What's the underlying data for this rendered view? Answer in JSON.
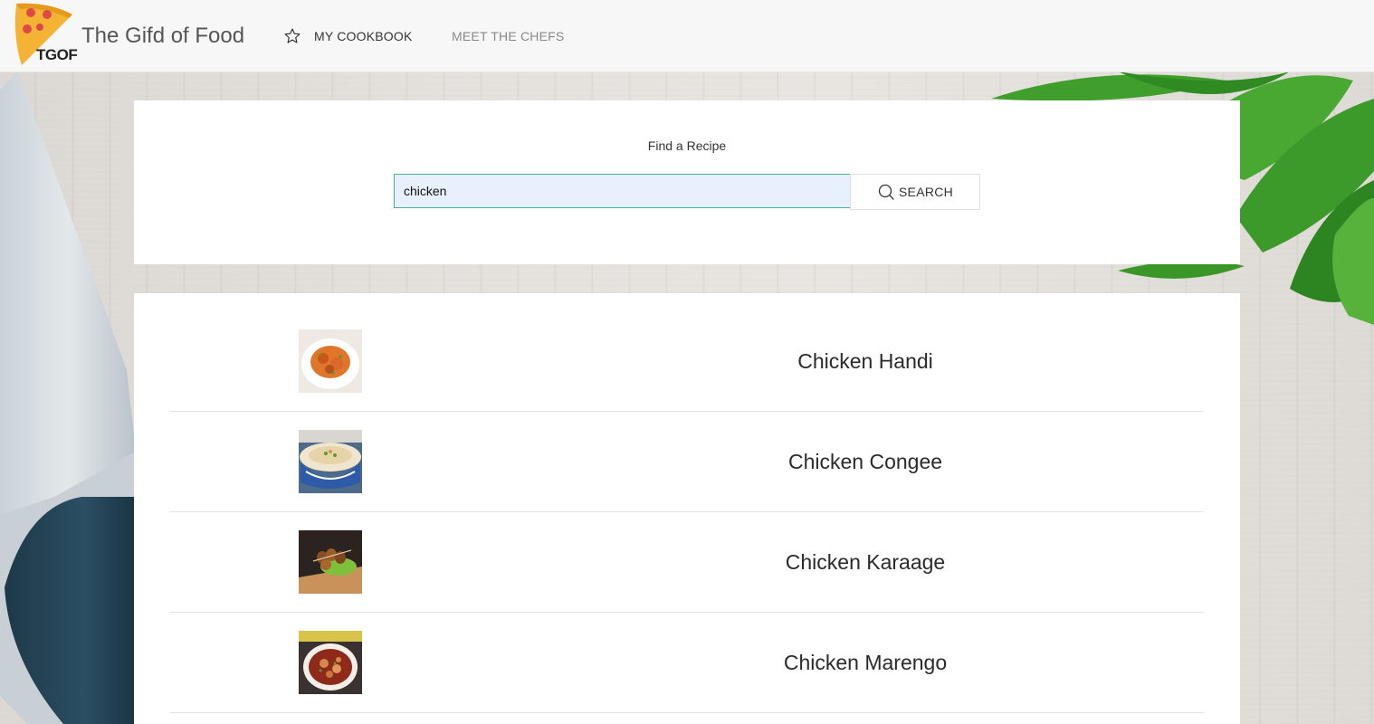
{
  "header": {
    "logo_text": "TGOF",
    "brand_title": "The Gifd of Food",
    "nav": {
      "cookbook_label": "MY COOKBOOK",
      "chefs_label": "MEET THE CHEFS"
    }
  },
  "search": {
    "title": "Find a Recipe",
    "query": "chicken",
    "button_label": "SEARCH"
  },
  "results": [
    {
      "name": "Chicken Handi",
      "thumb": "chicken-handi-photo"
    },
    {
      "name": "Chicken Congee",
      "thumb": "chicken-congee-photo"
    },
    {
      "name": "Chicken Karaage",
      "thumb": "chicken-karaage-photo"
    },
    {
      "name": "Chicken Marengo",
      "thumb": "chicken-marengo-photo"
    }
  ],
  "colors": {
    "input_border": "#3fb893",
    "input_bg": "#e8f0fe",
    "logo_pizza": "#f5b335",
    "logo_pepperoni": "#e04848"
  },
  "icons": {
    "logo": "pizza-slice-icon",
    "cookbook": "star-outline-icon",
    "search": "magnifier-icon"
  }
}
